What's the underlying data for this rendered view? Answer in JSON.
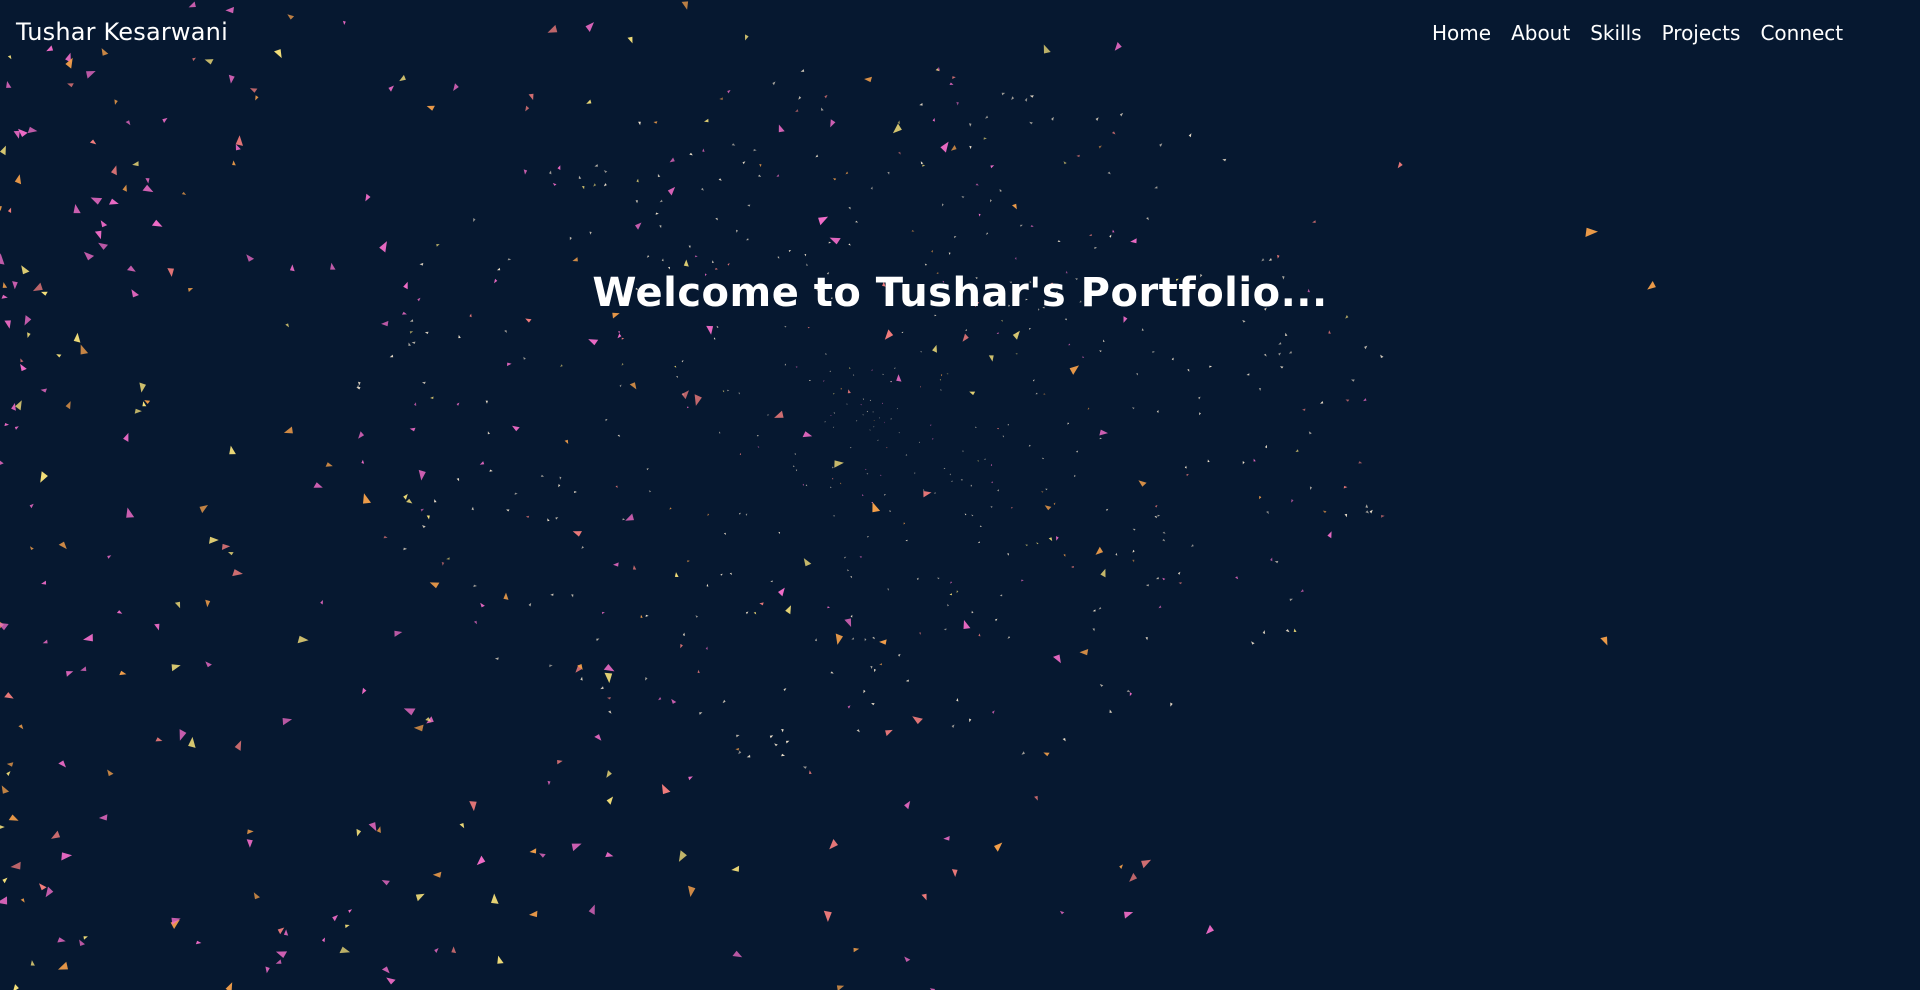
{
  "header": {
    "brand": "Tushar Kesarwani",
    "nav": [
      {
        "label": "Home"
      },
      {
        "label": "About"
      },
      {
        "label": "Skills"
      },
      {
        "label": "Projects"
      },
      {
        "label": "Connect"
      }
    ]
  },
  "hero": {
    "title": "Welcome to Tushar's Portfolio..."
  },
  "colors": {
    "background": "#061830",
    "text": "#ffffff",
    "particle_pink": "#f06cc8",
    "particle_orange": "#f5a04a",
    "particle_yellow": "#f7e27a",
    "particle_coral": "#f27c7c"
  }
}
